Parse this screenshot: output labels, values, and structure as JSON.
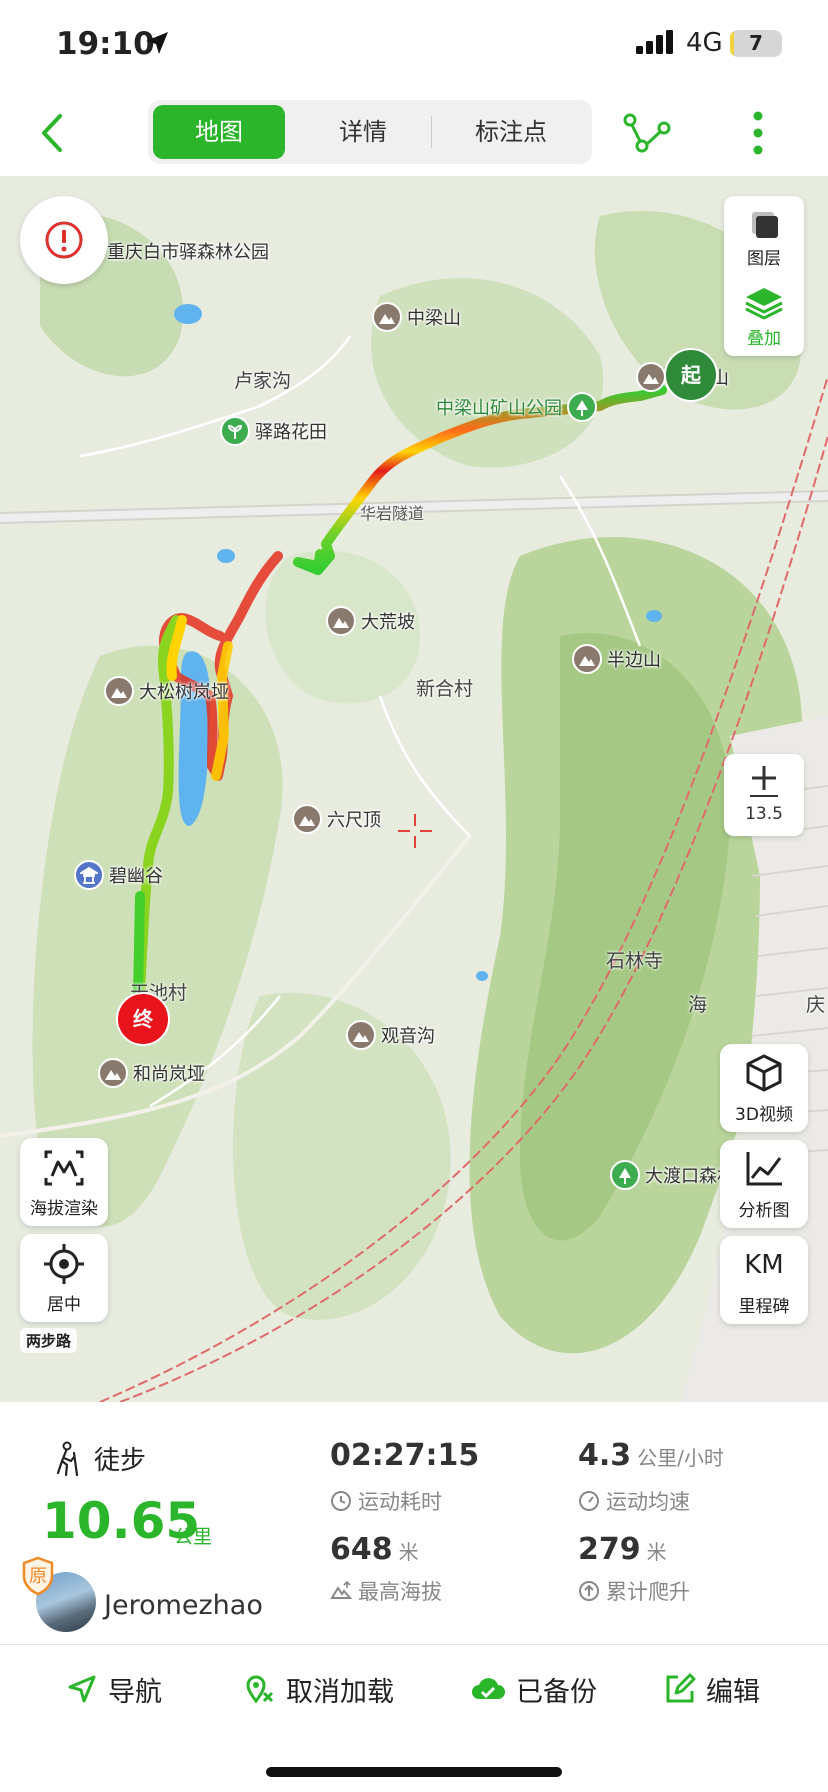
{
  "status_bar": {
    "time": "19:10",
    "network": "4G",
    "battery": "7",
    "battery_level_percent": 7
  },
  "header": {
    "tabs": [
      {
        "label": "地图",
        "active": true
      },
      {
        "label": "详情",
        "active": false
      },
      {
        "label": "标注点",
        "active": false
      }
    ]
  },
  "map": {
    "pois": [
      {
        "name": "重庆白市驿森林公园",
        "type": "park"
      },
      {
        "name": "中梁山",
        "type": "mountain"
      },
      {
        "name": "驿路花田",
        "type": "park"
      },
      {
        "name": "中梁山矿山公园",
        "type": "park"
      },
      {
        "name": "山",
        "type": "mountain"
      },
      {
        "name": "大荒坡",
        "type": "mountain"
      },
      {
        "name": "半边山",
        "type": "mountain"
      },
      {
        "name": "大松树岚垭",
        "type": "mountain"
      },
      {
        "name": "六尺顶",
        "type": "mountain"
      },
      {
        "name": "碧幽谷",
        "type": "temple"
      },
      {
        "name": "观音沟",
        "type": "mountain"
      },
      {
        "name": "和尚岚垭",
        "type": "mountain"
      },
      {
        "name": "大渡口森林公园",
        "type": "park"
      }
    ],
    "places": [
      "卢家沟",
      "新合村",
      "石林寺",
      "天池村",
      "海",
      "庆"
    ],
    "roads": [
      "华岩隧道"
    ],
    "start_label": "起",
    "end_label": "终",
    "layers": {
      "layer_label": "图层",
      "overlay_label": "叠加"
    },
    "zoom": {
      "level": "13.5"
    },
    "buttons": {
      "elevation_render": "海拔渲染",
      "center": "居中",
      "video_3d": "3D视频",
      "analysis": "分析图",
      "milestone_icon_text": "KM",
      "milestone": "里程碑"
    },
    "brand": "两步路",
    "colors": {
      "accent": "#2bb52b",
      "track_low": "#33cc33",
      "track_mid": "#ffd400",
      "track_high": "#e31b1b",
      "end_marker": "#e8131b",
      "start_marker": "#2f8a3a"
    }
  },
  "stats": {
    "activity": "徒步",
    "distance": "10.65",
    "distance_unit": "公里",
    "user_name": "Jeromezhao",
    "original_badge": "原",
    "duration": "02:27:15",
    "duration_label": "运动耗时",
    "avg_speed": "4.3",
    "avg_speed_unit": "公里/小时",
    "avg_speed_label": "运动均速",
    "max_altitude": "648",
    "max_altitude_unit": "米",
    "max_altitude_label": "最高海拔",
    "total_climb": "279",
    "total_climb_unit": "米",
    "total_climb_label": "累计爬升"
  },
  "actions": {
    "navigate": "导航",
    "cancel_load": "取消加载",
    "backed_up": "已备份",
    "edit": "编辑"
  }
}
